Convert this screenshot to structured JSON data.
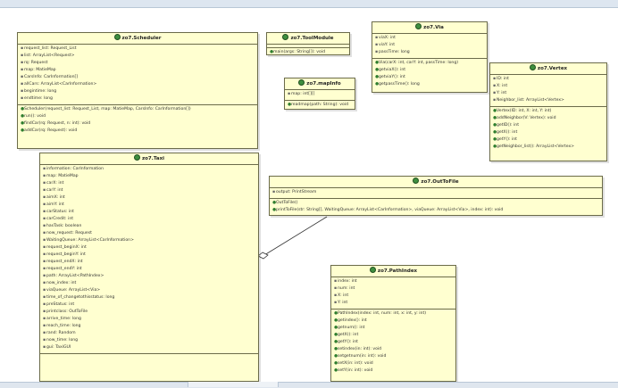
{
  "classes": {
    "scheduler": {
      "title": "zo7.Scheduler",
      "attributes": [
        "request_list: Request_List",
        "list: ArrayList<Request>",
        "rq: Request",
        "map: MatieMap",
        "CarsInfo: CarInformation[]",
        "allCars: ArrayList<CarInformation>",
        "begintime: long",
        "endtime: long"
      ],
      "methods": [
        "Scheduler(request_list: Request_List, map: MatieMap, CarsInfo: CarInformation[])",
        "run(): void",
        "findCar(rq: Request, n: int): void",
        "addCar(rq: Request): void"
      ]
    },
    "toolmodule": {
      "title": "zo7.ToolModule",
      "attributes": [],
      "methods": [
        "main(args: String[]): void"
      ]
    },
    "mapinfo": {
      "title": "zo7.mapInfo",
      "attributes": [
        "map: int[][]"
      ],
      "methods": [
        "readmap(path: String): void"
      ]
    },
    "via": {
      "title": "zo7.Via",
      "attributes": [
        "viaX: int",
        "viaY: int",
        "passTime: long"
      ],
      "methods": [
        "Via(carX: int, carY: int, passTime: long)",
        "getviaX(): int",
        "getviaY(): int",
        "getpassTime(): long"
      ]
    },
    "vertex": {
      "title": "zo7.Vertex",
      "attributes": [
        "ID: int",
        "X: int",
        "Y: int",
        "Neighbor_list: ArrayList<Vertex>"
      ],
      "methods": [
        "Vertex(ID: int, X: int, Y: int)",
        "addNeighbor(V: Vertex): void",
        "getID(): int",
        "getX(): int",
        "getY(): int",
        "getNeighbor_list(): ArrayList<Vertex>"
      ]
    },
    "taxi": {
      "title": "zo7.Taxi",
      "attributes": [
        "information: CarInformation",
        "map: MatieMap",
        "carX: int",
        "carY: int",
        "aimX: int",
        "aimY: int",
        "carStatus: int",
        "carCredit: int",
        "hasTask: boolean",
        "now_request: Request",
        "WaitingQueue: ArrayList<CarInformation>",
        "request_beginX: int",
        "request_beginY: int",
        "request_endX: int",
        "request_endY: int",
        "path: ArrayList<PathIndex>",
        "now_index: int",
        "viaQueue: ArrayList<Via>",
        "time_of_changetothisstatus: long",
        "preStatus: int",
        "printclass: OutToFile",
        "arrive_time: long",
        "reach_time: long",
        "rand: Random",
        "now_time: long",
        "gui: TaxiGUI"
      ],
      "methods": []
    },
    "outtofile": {
      "title": "zo7.OutToFile",
      "attributes": [
        "output: PrintStream"
      ],
      "methods": [
        "OutToFile()",
        "printToFile(str: String[], WaitingQueue: ArrayList<CarInformation>, viaQueue: ArrayList<Via>, index: int): void"
      ]
    },
    "pathindex": {
      "title": "zo7.PathIndex",
      "attributes": [
        "index: int",
        "num: int",
        "X: int",
        "Y: int"
      ],
      "methods": [
        "PathIndex(index: int, num: int, x: int, y: int)",
        "getindex(): int",
        "getnum(): int",
        "getX(): int",
        "getY(): int",
        "setindex(in: int): void",
        "setgetnum(in: int): void",
        "setX(in: int): void",
        "setY(in: int): void"
      ]
    }
  }
}
